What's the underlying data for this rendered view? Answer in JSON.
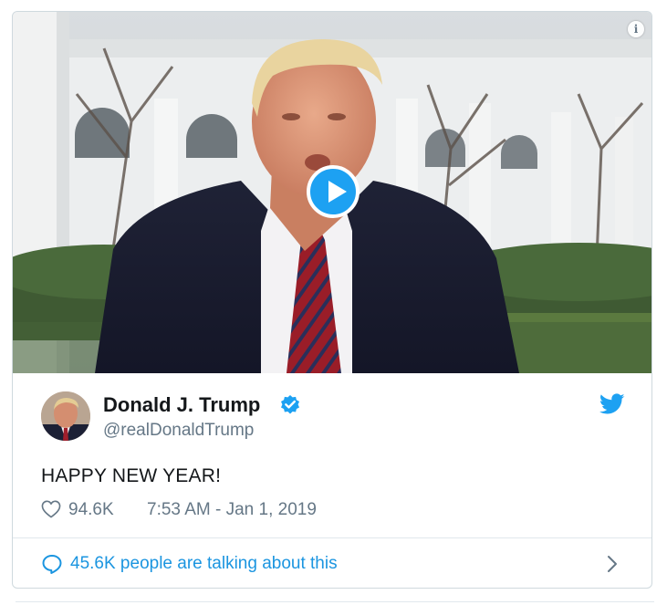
{
  "tweet": {
    "author_name": "Donald J. Trump",
    "handle": "@realDonaldTrump",
    "text": "HAPPY NEW YEAR!",
    "like_count": "94.6K",
    "timestamp": "7:53 AM - Jan 1, 2019",
    "talking_text": "45.6K people are talking about this"
  },
  "icons": {
    "info": "info-icon",
    "play": "play-icon",
    "verified": "verified-badge-icon",
    "twitter": "twitter-bird-icon",
    "like": "heart-icon",
    "reply": "speech-bubble-icon",
    "chevron": "chevron-right-icon"
  },
  "colors": {
    "accent": "#1da1f2",
    "link": "#1b95e0",
    "secondary_text": "#657786",
    "primary_text": "#14171a",
    "border": "#cfd9de"
  },
  "info_glyph": "i"
}
